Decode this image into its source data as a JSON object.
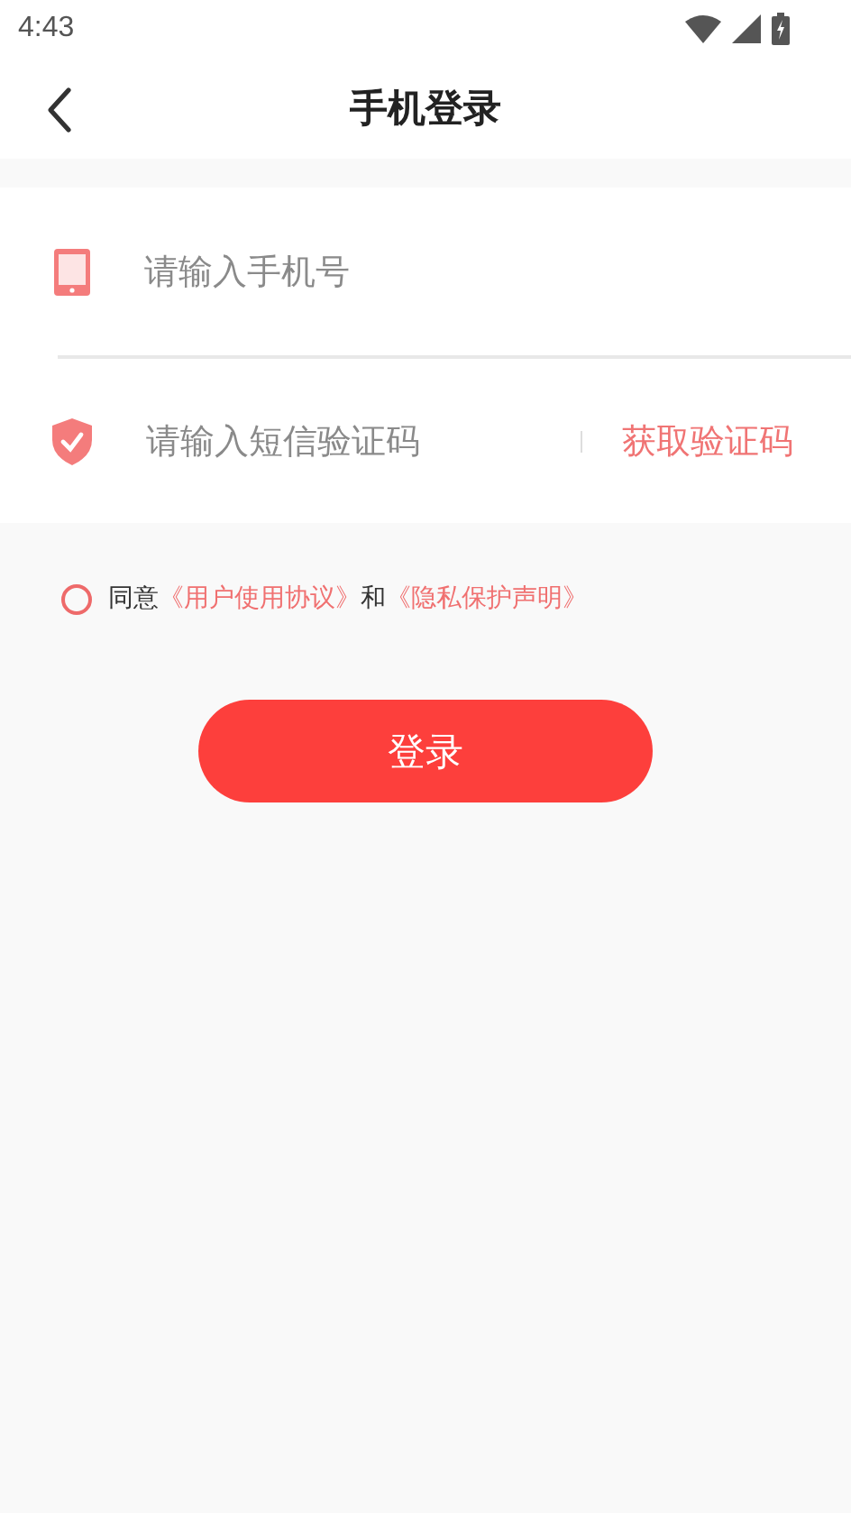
{
  "status_bar": {
    "time": "4:43"
  },
  "header": {
    "title": "手机登录"
  },
  "fields": [
    {
      "kind": "phone",
      "placeholder": "请输入手机号"
    },
    {
      "kind": "code",
      "placeholder": "请输入短信验证码",
      "action": "获取验证码"
    }
  ],
  "agreement": {
    "checked": false,
    "parts": [
      {
        "kind": "text",
        "text": "同意"
      },
      {
        "kind": "link",
        "text": "《用户使用协议》"
      },
      {
        "kind": "text",
        "text": "和"
      },
      {
        "kind": "link",
        "text": "《隐私保护声明》"
      }
    ]
  },
  "login_button": {
    "label": "登录"
  }
}
